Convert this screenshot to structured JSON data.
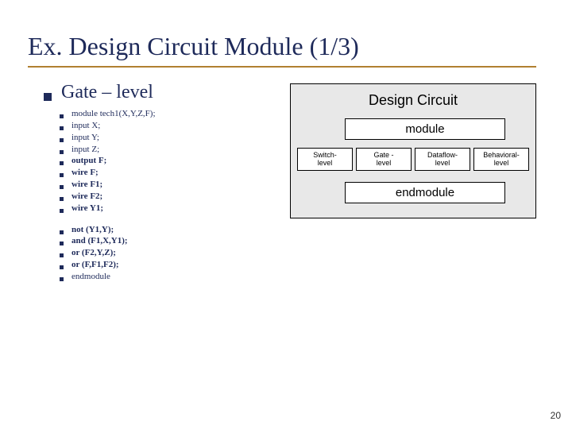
{
  "title": "Ex. Design Circuit Module (1/3)",
  "subheading": "Gate – level",
  "code_block_1": [
    {
      "text": "module tech1(X,Y,Z,F);",
      "bold": false
    },
    {
      "text": "input X;",
      "bold": false
    },
    {
      "text": "input Y;",
      "bold": false
    },
    {
      "text": "input Z;",
      "bold": false
    },
    {
      "text": "output F;",
      "bold": true
    },
    {
      "text": "wire F;",
      "bold": true
    },
    {
      "text": "wire F1;",
      "bold": true
    },
    {
      "text": "wire F2;",
      "bold": true
    },
    {
      "text": "wire Y1;",
      "bold": true
    }
  ],
  "code_block_2": [
    {
      "text": "not (Y1,Y);",
      "bold": true
    },
    {
      "text": "and (F1,X,Y1);",
      "bold": true
    },
    {
      "text": "or (F2,Y,Z);",
      "bold": true
    },
    {
      "text": "or (F,F1,F2);",
      "bold": true
    },
    {
      "text": "endmodule",
      "bold": false
    }
  ],
  "diagram": {
    "title": "Design Circuit",
    "module_label": "module",
    "end_label": "endmodule",
    "levels": [
      "Switch-\nlevel",
      "Gate -\nlevel",
      "Dataflow-\nlevel",
      "Behavioral-\nlevel"
    ]
  },
  "page_number": "20"
}
